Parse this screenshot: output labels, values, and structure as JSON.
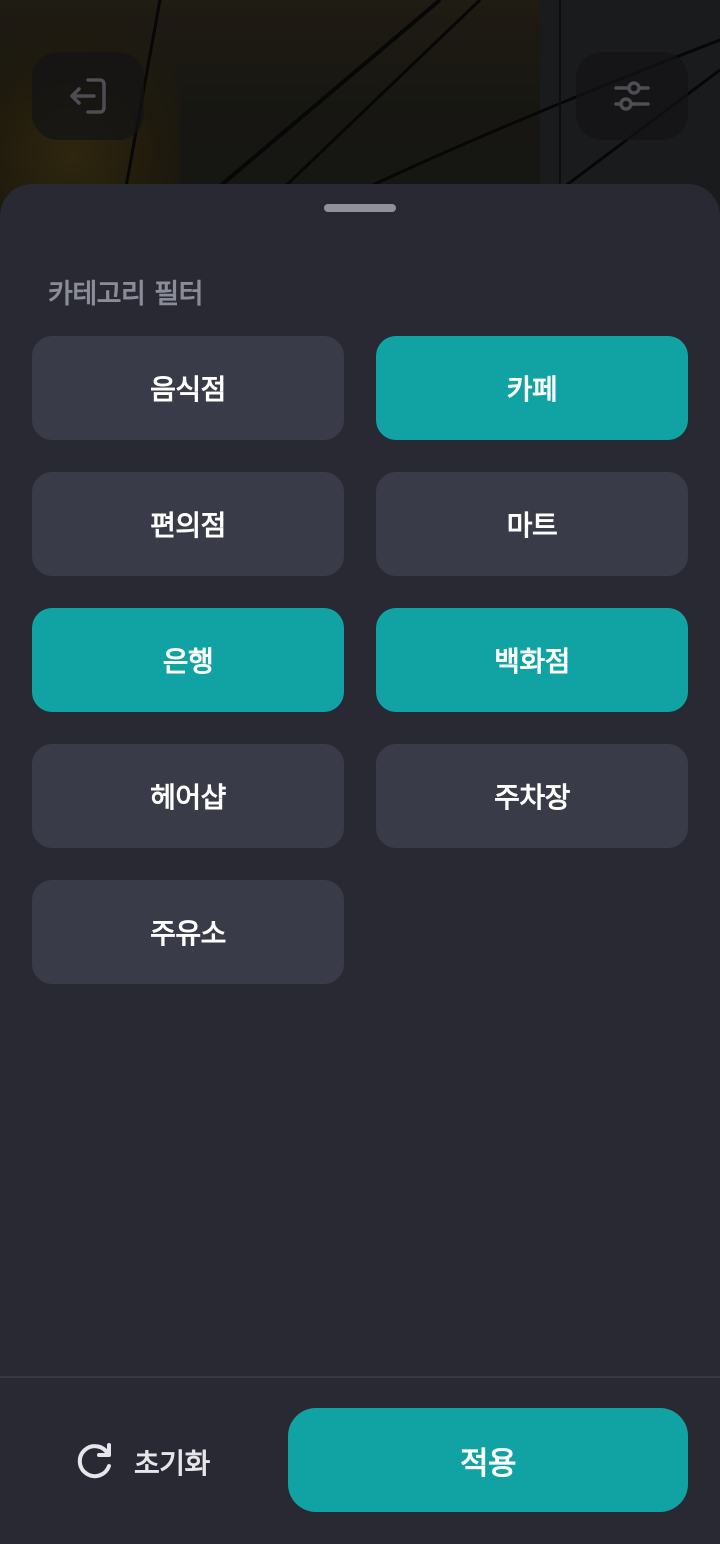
{
  "header": {
    "exit_icon": "exit-icon",
    "filter_icon": "sliders-icon"
  },
  "sheet": {
    "title": "카테고리 필터",
    "categories": [
      {
        "label": "음식점",
        "selected": false
      },
      {
        "label": "카페",
        "selected": true
      },
      {
        "label": "편의점",
        "selected": false
      },
      {
        "label": "마트",
        "selected": false
      },
      {
        "label": "은행",
        "selected": true
      },
      {
        "label": "백화점",
        "selected": true
      },
      {
        "label": "헤어샵",
        "selected": false
      },
      {
        "label": "주차장",
        "selected": false
      },
      {
        "label": "주유소",
        "selected": false
      }
    ]
  },
  "footer": {
    "reset_label": "초기화",
    "reset_icon": "refresh-icon",
    "apply_label": "적용"
  },
  "colors": {
    "accent": "#11a3a3",
    "sheet_bg": "#282933",
    "chip_bg": "#393b49"
  }
}
